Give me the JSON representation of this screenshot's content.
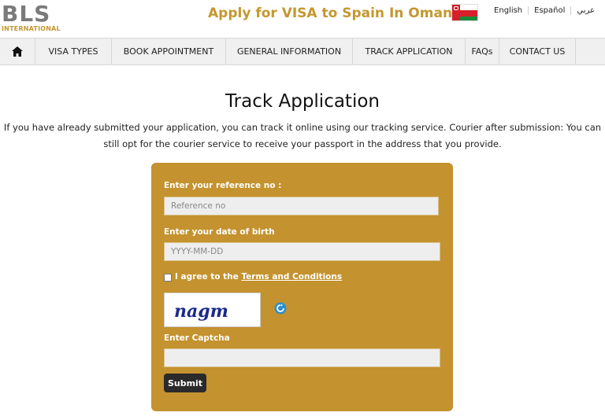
{
  "header": {
    "logo_main": "BLS",
    "logo_sub": "INTERNATIONAL",
    "title": "Apply for VISA to Spain In Oman",
    "languages": [
      "English",
      "Español",
      "عربي"
    ]
  },
  "nav": {
    "items": [
      "VISA TYPES",
      "BOOK APPOINTMENT",
      "GENERAL INFORMATION",
      "TRACK APPLICATION",
      "FAQs",
      "CONTACT US"
    ]
  },
  "main": {
    "title": "Track Application",
    "intro_line1": "If you have already submitted your application, you can track it online using our tracking service. Courier after submission: You can",
    "intro_line2": "still opt for the courier service to receive your passport in the address that you provide."
  },
  "form": {
    "reference_label": "Enter your reference no :",
    "reference_placeholder": "Reference no",
    "dob_label": "Enter your date of birth",
    "dob_placeholder": "YYYY-MM-DD",
    "agree_text": "I agree to the",
    "terms_link": "Terms and Conditions",
    "captcha_text": "nagm",
    "captcha_label": "Enter Captcha",
    "submit_label": "Submit"
  },
  "colors": {
    "brand_gold": "#c4922e",
    "title_gold": "#c4972f",
    "nav_bg": "#f0f0f0",
    "button_dark": "#2a2a2a"
  }
}
